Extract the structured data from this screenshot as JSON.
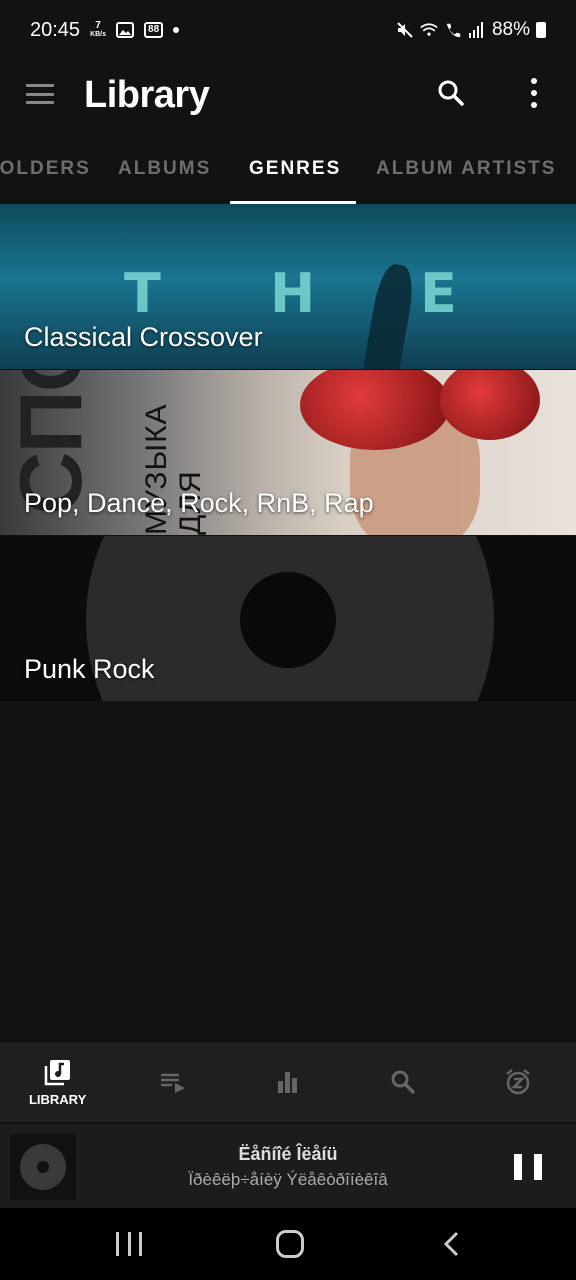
{
  "status_bar": {
    "time": "20:45",
    "speed_value": "7",
    "speed_unit": "KB/s",
    "badge": "88",
    "battery": "88%"
  },
  "app_bar": {
    "title": "Library",
    "icons": [
      "menu-icon",
      "search-icon",
      "more-vert-icon"
    ]
  },
  "tabs": [
    {
      "label": "FOLDERS"
    },
    {
      "label": "ALBUMS"
    },
    {
      "label": "GENRES",
      "active": true
    },
    {
      "label": "ALBUM ARTISTS"
    }
  ],
  "genres": [
    {
      "name": "Classical Crossover",
      "art_letters": [
        "T",
        "H",
        "E"
      ]
    },
    {
      "name": "Pop, Dance, Rock, RnB, Rap",
      "art_text": "СПОРТ",
      "art_sub": "МУЗЫКА ДЛЯ"
    },
    {
      "name": "Punk Rock"
    }
  ],
  "bottom_nav": [
    {
      "icon": "library-music-icon",
      "label": "LIBRARY",
      "active": true
    },
    {
      "icon": "queue-icon",
      "label": ""
    },
    {
      "icon": "equalizer-icon",
      "label": ""
    },
    {
      "icon": "search-icon",
      "label": ""
    },
    {
      "icon": "sleep-timer-icon",
      "label": ""
    }
  ],
  "now_playing": {
    "title": "Ëåñíîé Îëåíü",
    "subtitle": "Ïðèêëþ÷åíèÿ Ýëåêòðîíèêîâ"
  },
  "colors": {
    "background": "#121212",
    "nav_background": "#1f1f1f",
    "tab_inactive": "#6e6e6e",
    "accent": "#ffffff"
  }
}
